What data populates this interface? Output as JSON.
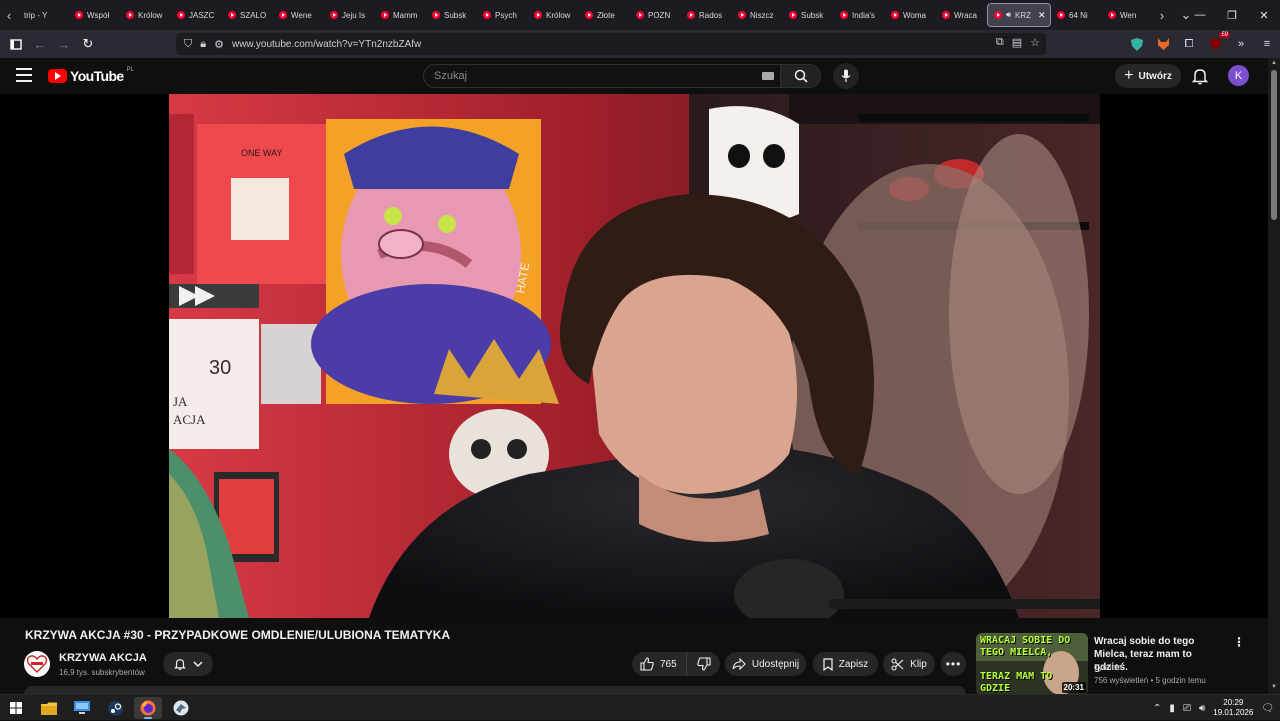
{
  "browser": {
    "tabs": [
      {
        "label": "trip - Y"
      },
      {
        "label": "Współ"
      },
      {
        "label": "Królow"
      },
      {
        "label": "JASZC"
      },
      {
        "label": "SZALO"
      },
      {
        "label": "Wene"
      },
      {
        "label": "Jeju Is"
      },
      {
        "label": "Mamm"
      },
      {
        "label": "Subsk"
      },
      {
        "label": "Psych"
      },
      {
        "label": "Królow"
      },
      {
        "label": "Złote"
      },
      {
        "label": "POZN"
      },
      {
        "label": "Rados"
      },
      {
        "label": "Niszcz"
      },
      {
        "label": "Subsk"
      },
      {
        "label": "India's"
      },
      {
        "label": "Woma"
      },
      {
        "label": "Wraca"
      },
      {
        "label": "KRZ",
        "active": true
      },
      {
        "label": "64 Ni"
      },
      {
        "label": "Wen"
      }
    ],
    "url": "www.youtube.com/watch?v=YTn2nzbZAfw",
    "extension_badge": "59"
  },
  "youtube": {
    "logo_text": "YouTube",
    "country_code": "PL",
    "search_placeholder": "Szukaj",
    "create_label": "Utwórz",
    "avatar_letter": "K"
  },
  "video": {
    "title": "KRZYWA AKCJA #30 - PRZYPADKOWE OMDLENIE/ULUBIONA TEMATYKA",
    "channel_name": "KRZYWA AKCJA",
    "subscribers": "16,9 tys. subskrybentów",
    "likes": "765",
    "share_label": "Udostępnij",
    "save_label": "Zapisz",
    "clip_label": "Klip",
    "scene_art": {
      "poster_text": "ONE WAY",
      "card_number": "30",
      "card_text_1": "JA",
      "card_text_2": "ACJA",
      "neon_text": "HATE"
    }
  },
  "recommendation": {
    "title": "Wracaj sobie do tego Mielca, teraz mam to gdzieś.",
    "channel": "Tyralnia",
    "meta": "756 wyświetleń • 5 godzin temu",
    "duration": "20:31",
    "thumb_text_top": "WRACAJ SOBIE DO TEGO MIELCA,",
    "thumb_text_bottom": "TERAZ MAM TO GDZIE"
  },
  "taskbar": {
    "time": "20:29",
    "date": "19.01.2026"
  },
  "colors": {
    "yt_red": "#ff0000",
    "bg": "#0f0f0f",
    "pill": "#272727",
    "avatar_purple": "#7b4fd0"
  }
}
